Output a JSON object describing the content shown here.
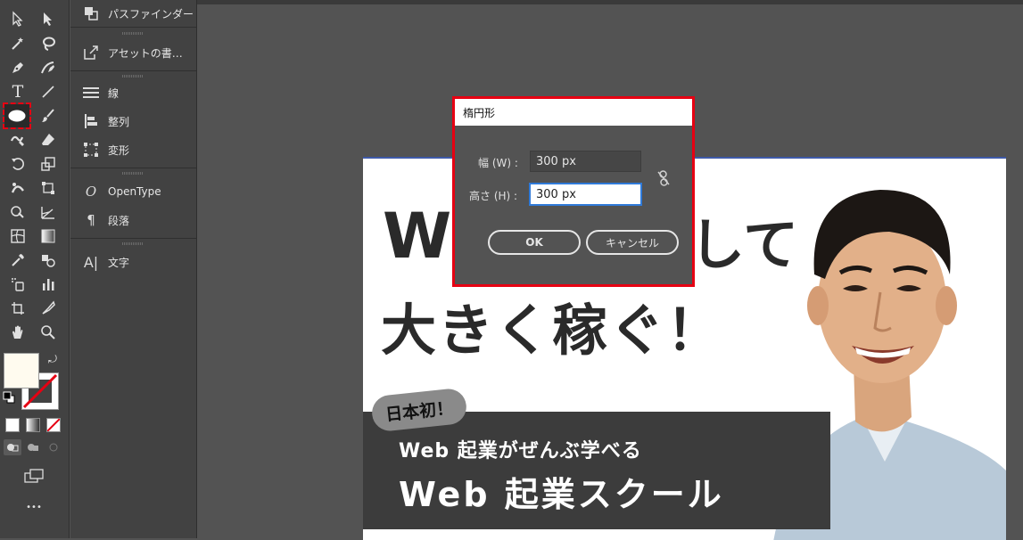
{
  "panel": {
    "items": [
      {
        "label": "パスファインダー",
        "icon": "pathfinder-icon"
      },
      {
        "label": "アセットの書…",
        "icon": "asset-export-icon"
      },
      {
        "label": "線",
        "icon": "stroke-icon"
      },
      {
        "label": "整列",
        "icon": "align-icon"
      },
      {
        "label": "変形",
        "icon": "transform-icon"
      },
      {
        "label": "OpenType",
        "icon": "opentype-icon"
      },
      {
        "label": "段落",
        "icon": "paragraph-icon"
      },
      {
        "label": "文字",
        "icon": "character-icon"
      }
    ]
  },
  "toolbar": {
    "type_glyph": "T",
    "more_glyph": "•••"
  },
  "dialog": {
    "title": "楕円形",
    "width_label": "幅 (W) :",
    "height_label": "高さ (H) :",
    "width_value": "300 px",
    "height_value": "300 px",
    "ok_label": "OK",
    "cancel_label": "キャンセル"
  },
  "artboard": {
    "headline_line1_left": "W",
    "headline_line1_right": "して",
    "headline_line2": "大きく稼ぐ！",
    "badge": "日本初！",
    "banner_line1": "Web 起業がぜんぶ学べる",
    "banner_line2": "Web 起業スクール"
  },
  "colors": {
    "highlight": "#e60012",
    "artboard_edge": "#3e5aa8",
    "fill_swatch": "#fffbef"
  }
}
